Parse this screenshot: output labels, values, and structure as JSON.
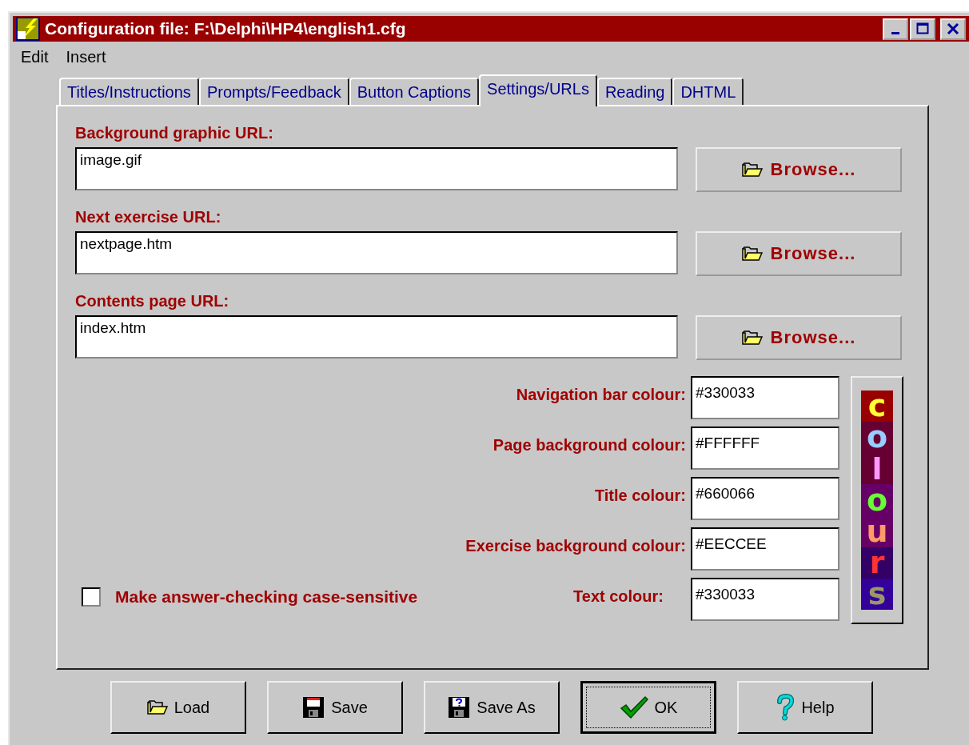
{
  "window": {
    "title": "Configuration file: F:\\Delphi\\HP4\\english1.cfg"
  },
  "menu": [
    "Edit",
    "Insert"
  ],
  "tabs": [
    {
      "label": "Titles/Instructions",
      "selected": false
    },
    {
      "label": "Prompts/Feedback",
      "selected": false
    },
    {
      "label": "Button Captions",
      "selected": false
    },
    {
      "label": "Settings/URLs",
      "selected": true
    },
    {
      "label": "Reading",
      "selected": false
    },
    {
      "label": "DHTML",
      "selected": false
    }
  ],
  "url_fields": [
    {
      "label": "Background graphic URL:",
      "value": "image.gif",
      "button": "Browse..."
    },
    {
      "label": "Next exercise URL:",
      "value": "nextpage.htm",
      "button": "Browse..."
    },
    {
      "label": "Contents page URL:",
      "value": "index.htm",
      "button": "Browse..."
    }
  ],
  "colour_fields": [
    {
      "label": "Navigation bar colour:",
      "value": "#330033"
    },
    {
      "label": "Page background colour:",
      "value": "#FFFFFF"
    },
    {
      "label": "Title colour:",
      "value": "#660066"
    },
    {
      "label": "Exercise background colour:",
      "value": "#EECCEE"
    },
    {
      "label": "Text colour:",
      "value": "#330033"
    }
  ],
  "case_sensitive": {
    "label": "Make answer-checking case-sensitive",
    "checked": false
  },
  "colours_button": {
    "letters": [
      {
        "char": "c",
        "color": "#ffff33"
      },
      {
        "char": "o",
        "color": "#99ccff"
      },
      {
        "char": "l",
        "color": "#ff99ff"
      },
      {
        "char": "o",
        "color": "#66ff33"
      },
      {
        "char": "u",
        "color": "#ff9966"
      },
      {
        "char": "r",
        "color": "#ff3333"
      },
      {
        "char": "s",
        "color": "#999966"
      }
    ]
  },
  "buttons": [
    {
      "kind": "load",
      "label": "Load"
    },
    {
      "kind": "save",
      "label": "Save"
    },
    {
      "kind": "saveas",
      "label": "Save As"
    },
    {
      "kind": "ok",
      "label": "OK"
    },
    {
      "kind": "help",
      "label": "Help"
    }
  ]
}
